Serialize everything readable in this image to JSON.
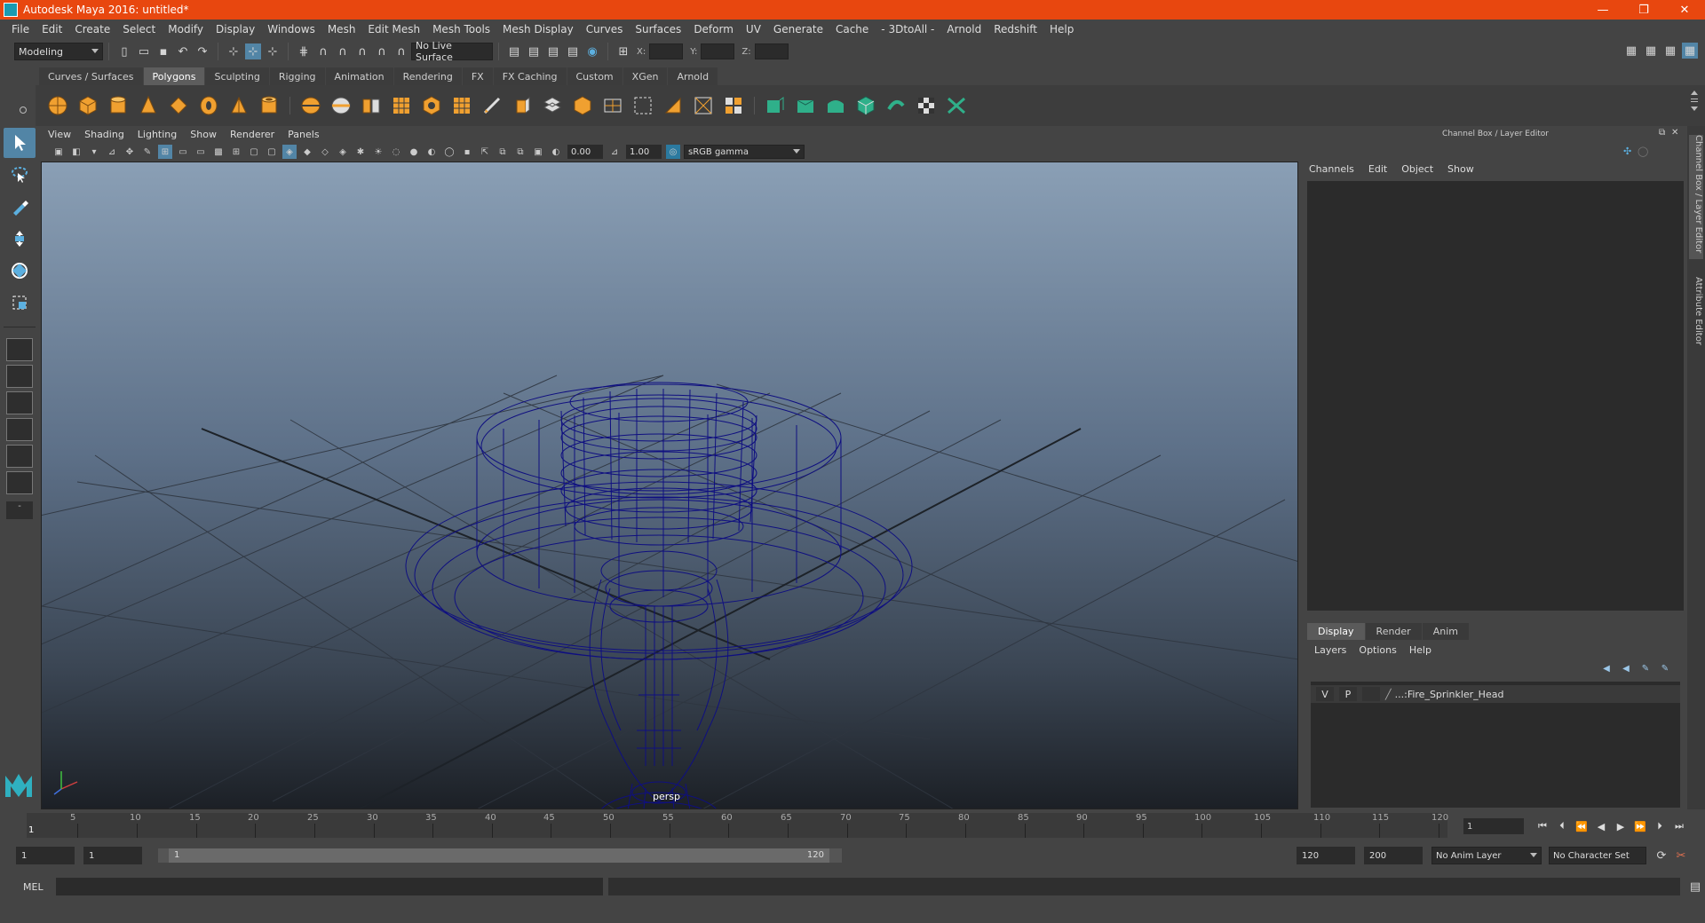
{
  "window": {
    "title": "Autodesk Maya 2016: untitled*",
    "minimize": "—",
    "maximize": "❐",
    "close": "✕"
  },
  "menubar": [
    "File",
    "Edit",
    "Create",
    "Select",
    "Modify",
    "Display",
    "Windows",
    "Mesh",
    "Edit Mesh",
    "Mesh Tools",
    "Mesh Display",
    "Curves",
    "Surfaces",
    "Deform",
    "UV",
    "Generate",
    "Cache",
    "- 3DtoAll -",
    "Arnold",
    "Redshift",
    "Help"
  ],
  "statusline": {
    "mode": "Modeling",
    "live_surface": "No Live Surface",
    "x_label": "X:",
    "y_label": "Y:",
    "z_label": "Z:"
  },
  "shelf_tabs": [
    "Curves / Surfaces",
    "Polygons",
    "Sculpting",
    "Rigging",
    "Animation",
    "Rendering",
    "FX",
    "FX Caching",
    "Custom",
    "XGen",
    "Arnold"
  ],
  "shelf_active": "Polygons",
  "viewport": {
    "menu": [
      "View",
      "Shading",
      "Lighting",
      "Show",
      "Renderer",
      "Panels"
    ],
    "exposure": "0.00",
    "gamma": "1.00",
    "color_space": "sRGB gamma",
    "camera_label": "persp"
  },
  "channel_box": {
    "header": "Channel Box / Layer Editor",
    "menu": [
      "Channels",
      "Edit",
      "Object",
      "Show"
    ]
  },
  "layer_editor": {
    "tabs": [
      "Display",
      "Render",
      "Anim"
    ],
    "menu": [
      "Layers",
      "Options",
      "Help"
    ],
    "layer": {
      "v": "V",
      "p": "P",
      "name": "...:Fire_Sprinkler_Head"
    }
  },
  "side_tabs": [
    "Channel Box / Layer Editor",
    "Attribute Editor"
  ],
  "timeline": {
    "ticks": [
      "5",
      "10",
      "15",
      "20",
      "25",
      "30",
      "35",
      "40",
      "45",
      "50",
      "55",
      "60",
      "65",
      "70",
      "75",
      "80",
      "85",
      "90",
      "95",
      "100",
      "105",
      "110",
      "115",
      "120"
    ],
    "start_marker": "1",
    "current_frame": "1"
  },
  "range": {
    "start": "1",
    "playback_start": "1",
    "slider_start": "1",
    "slider_end": "120",
    "playback_end": "120",
    "end": "200",
    "anim_layer": "No Anim Layer",
    "character_set": "No Character Set"
  },
  "command_line": {
    "label": "MEL"
  },
  "colors": {
    "title_bar": "#e8470f",
    "active_tool": "#5285a6",
    "wireframe": "#0f0f80",
    "shelf_orange": "#f0a030",
    "shelf_green": "#2fb08a"
  }
}
